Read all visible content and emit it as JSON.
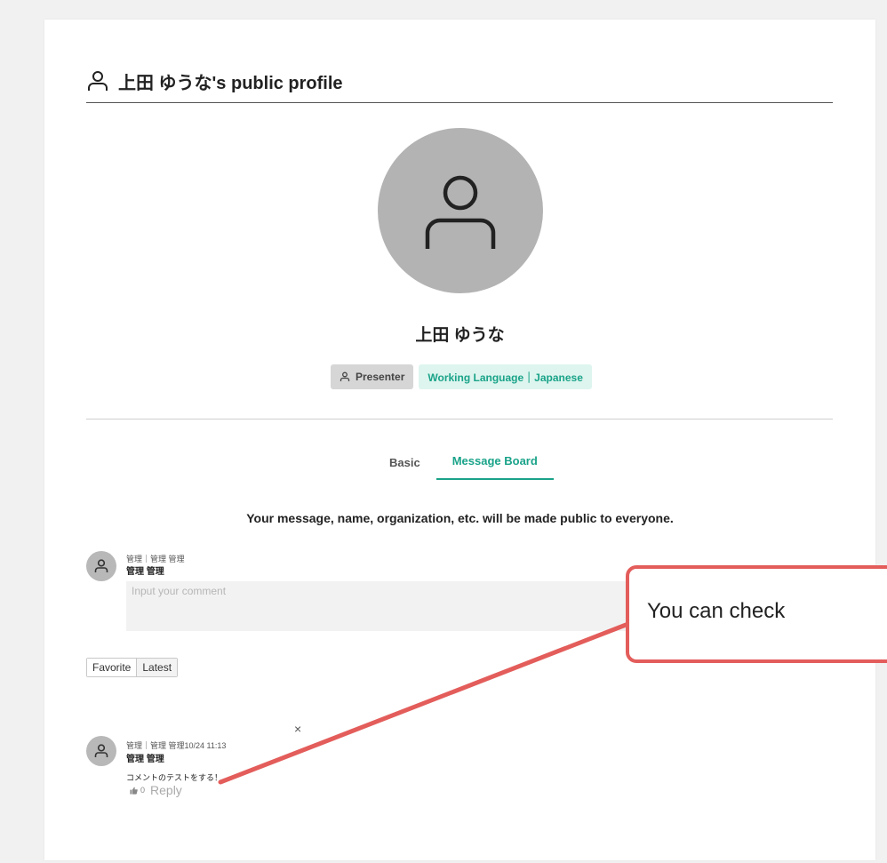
{
  "header": {
    "title": "上田 ゆうな's public profile"
  },
  "profile": {
    "name": "上田 ゆうな",
    "presenter_label": "Presenter",
    "language_badge": "Working Language｜Japanese"
  },
  "tabs": [
    {
      "label": "Basic",
      "active": false
    },
    {
      "label": "Message Board",
      "active": true
    }
  ],
  "notice": "Your message, name, organization, etc. will be made public to everyone.",
  "composer": {
    "meta": "管理｜管理 管理",
    "name": "管理 管理",
    "placeholder": "Input your comment"
  },
  "sort": {
    "favorite": "Favorite",
    "latest": "Latest"
  },
  "comment": {
    "meta": "管理｜管理 管理10/24 11:13",
    "name": "管理 管理",
    "text": "コメントのテストをする！",
    "likes": "0",
    "reply": "Reply",
    "close": "×"
  },
  "callout": {
    "text": "You can check"
  },
  "colors": {
    "accent": "#1aa389",
    "callout_border": "#e35d5b",
    "avatar_bg": "#b3b3b3"
  }
}
